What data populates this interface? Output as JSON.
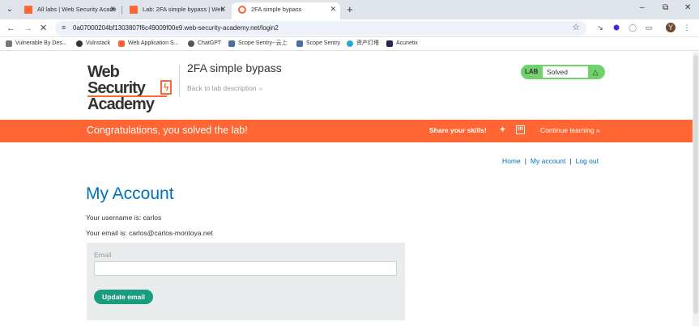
{
  "browser": {
    "tabs": [
      {
        "title": "All labs | Web Security Acade",
        "active": false
      },
      {
        "title": "Lab: 2FA simple bypass | Web",
        "active": false
      },
      {
        "title": "2FA simple bypass",
        "active": true
      }
    ],
    "new_tab": "+",
    "url": "0a07000204bf1303807f6c49009f00e9.web-security-academy.net/login2",
    "bookmarks": [
      "Vulnerable By Des...",
      "Vulnstack",
      "Web Application S...",
      "ChatGPT",
      "Scope Sentry--云上",
      "Scope Sentry",
      "资产灯塔",
      "Acunetix"
    ],
    "profile_initial": "Y"
  },
  "header": {
    "logo_line1": "Web Security",
    "logo_line2": "Academy",
    "logo_mark": "ϟ",
    "lab_title": "2FA simple bypass",
    "back_link": "Back to lab description",
    "status_label": "LAB",
    "status_value": "Solved"
  },
  "banner": {
    "congrats": "Congratulations, you solved the lab!",
    "share": "Share your skills!",
    "continue": "Continue learning"
  },
  "nav": {
    "home": "Home",
    "my_account": "My account",
    "logout": "Log out",
    "separator": "|"
  },
  "account": {
    "heading": "My Account",
    "username_line": "Your username is: carlos",
    "email_line": "Your email is: carlos@carlos-montoya.net",
    "email_label": "Email",
    "email_value": "",
    "update_button": "Update email"
  },
  "colors": {
    "accent_orange": "#ff6633",
    "link_blue": "#0071bc",
    "solved_green": "#70d16d",
    "button_green": "#1b9c7e"
  }
}
